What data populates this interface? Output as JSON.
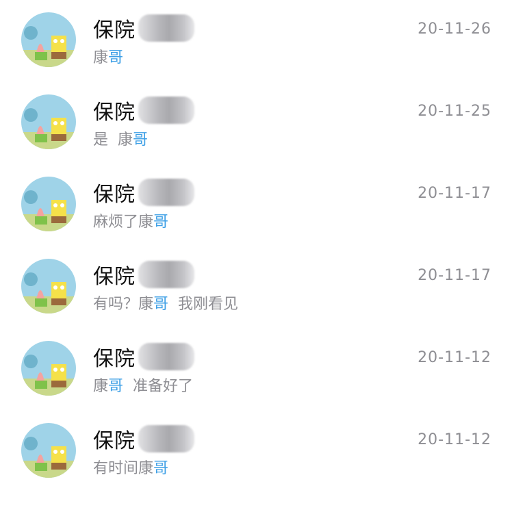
{
  "conversations": [
    {
      "name": "保院",
      "preview_before": "",
      "mention": "哥",
      "preview_prefix": "康",
      "preview_after": "",
      "date": "20-11-26"
    },
    {
      "name": "保院",
      "preview_before": "是  ",
      "mention": "哥",
      "preview_prefix": "康",
      "preview_after": "",
      "date": "20-11-25"
    },
    {
      "name": "保院",
      "preview_before": "麻烦了",
      "mention": "哥",
      "preview_prefix": "康",
      "preview_after": "",
      "date": "20-11-17"
    },
    {
      "name": "保院",
      "preview_before": "有吗？",
      "mention": "哥",
      "preview_prefix": "康",
      "preview_after": "  我刚看见",
      "date": "20-11-17"
    },
    {
      "name": "保院",
      "preview_before": "",
      "mention": "哥",
      "preview_prefix": "康",
      "preview_after": "  准备好了",
      "date": "20-11-12"
    },
    {
      "name": "保院",
      "preview_before": "有时间",
      "mention": "哥",
      "preview_prefix": "康",
      "preview_after": "",
      "date": "20-11-12"
    }
  ],
  "colors": {
    "mention": "#3fa0e6",
    "secondary_text": "#8e8e93",
    "primary_text": "#111111"
  },
  "avatar_icon": "cartoon-avatar-icon"
}
